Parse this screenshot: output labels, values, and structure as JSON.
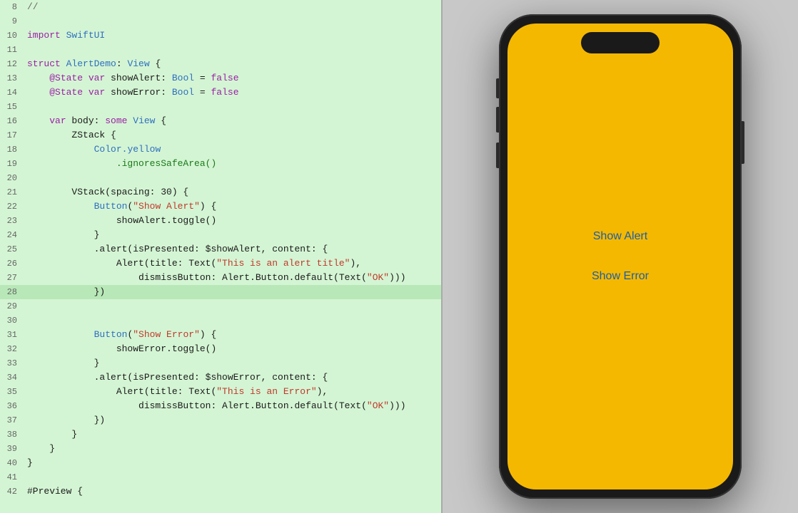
{
  "editor": {
    "background": "#d4f5d4",
    "lines": [
      {
        "num": 8,
        "tokens": [
          {
            "text": "//",
            "class": "comment"
          }
        ],
        "highlighted": false
      },
      {
        "num": 9,
        "tokens": [],
        "highlighted": false
      },
      {
        "num": 10,
        "tokens": [
          {
            "text": "import ",
            "class": "kw"
          },
          {
            "text": "SwiftUI",
            "class": "type"
          }
        ],
        "highlighted": false
      },
      {
        "num": 11,
        "tokens": [],
        "highlighted": false
      },
      {
        "num": 12,
        "tokens": [
          {
            "text": "struct ",
            "class": "kw"
          },
          {
            "text": "AlertDemo",
            "class": "type"
          },
          {
            "text": ": ",
            "class": "plain"
          },
          {
            "text": "View",
            "class": "type"
          },
          {
            "text": " {",
            "class": "plain"
          }
        ],
        "highlighted": false
      },
      {
        "num": 13,
        "tokens": [
          {
            "text": "    ",
            "class": "plain"
          },
          {
            "text": "@State",
            "class": "kw"
          },
          {
            "text": " ",
            "class": "plain"
          },
          {
            "text": "var",
            "class": "kw"
          },
          {
            "text": " showAlert: ",
            "class": "plain"
          },
          {
            "text": "Bool",
            "class": "type"
          },
          {
            "text": " = ",
            "class": "plain"
          },
          {
            "text": "false",
            "class": "kw"
          }
        ],
        "highlighted": false
      },
      {
        "num": 14,
        "tokens": [
          {
            "text": "    ",
            "class": "plain"
          },
          {
            "text": "@State",
            "class": "kw"
          },
          {
            "text": " ",
            "class": "plain"
          },
          {
            "text": "var",
            "class": "kw"
          },
          {
            "text": " showError: ",
            "class": "plain"
          },
          {
            "text": "Bool",
            "class": "type"
          },
          {
            "text": " = ",
            "class": "plain"
          },
          {
            "text": "false",
            "class": "kw"
          }
        ],
        "highlighted": false
      },
      {
        "num": 15,
        "tokens": [],
        "highlighted": false
      },
      {
        "num": 16,
        "tokens": [
          {
            "text": "    ",
            "class": "plain"
          },
          {
            "text": "var",
            "class": "kw"
          },
          {
            "text": " body: ",
            "class": "plain"
          },
          {
            "text": "some",
            "class": "kw"
          },
          {
            "text": " ",
            "class": "plain"
          },
          {
            "text": "View",
            "class": "type"
          },
          {
            "text": " {",
            "class": "plain"
          }
        ],
        "highlighted": false
      },
      {
        "num": 17,
        "tokens": [
          {
            "text": "        ZStack {",
            "class": "plain"
          }
        ],
        "highlighted": false
      },
      {
        "num": 18,
        "tokens": [
          {
            "text": "            ",
            "class": "plain"
          },
          {
            "text": "Color",
            "class": "type"
          },
          {
            "text": ".yellow",
            "class": "prop"
          }
        ],
        "highlighted": false
      },
      {
        "num": 19,
        "tokens": [
          {
            "text": "                .ignoresSafeArea()",
            "class": "func"
          }
        ],
        "highlighted": false
      },
      {
        "num": 20,
        "tokens": [],
        "highlighted": false
      },
      {
        "num": 21,
        "tokens": [
          {
            "text": "        VStack(spacing: 30) {",
            "class": "plain"
          }
        ],
        "highlighted": false
      },
      {
        "num": 22,
        "tokens": [
          {
            "text": "            ",
            "class": "plain"
          },
          {
            "text": "Button",
            "class": "type"
          },
          {
            "text": "(",
            "class": "plain"
          },
          {
            "text": "\"Show Alert\"",
            "class": "str"
          },
          {
            "text": ") {",
            "class": "plain"
          }
        ],
        "highlighted": false
      },
      {
        "num": 23,
        "tokens": [
          {
            "text": "                showAlert.toggle()",
            "class": "plain"
          }
        ],
        "highlighted": false
      },
      {
        "num": 24,
        "tokens": [
          {
            "text": "            }",
            "class": "plain"
          }
        ],
        "highlighted": false
      },
      {
        "num": 25,
        "tokens": [
          {
            "text": "            .alert(isPresented: $showAlert, content: {",
            "class": "plain"
          }
        ],
        "highlighted": false
      },
      {
        "num": 26,
        "tokens": [
          {
            "text": "                Alert(title: Text(",
            "class": "plain"
          },
          {
            "text": "\"This is an alert title\"",
            "class": "str"
          },
          {
            "text": "),",
            "class": "plain"
          }
        ],
        "highlighted": false
      },
      {
        "num": 27,
        "tokens": [
          {
            "text": "                    dismissButton: Alert.Button.default(Text(",
            "class": "plain"
          },
          {
            "text": "\"OK\"",
            "class": "str"
          },
          {
            "text": ")))",
            "class": "plain"
          }
        ],
        "highlighted": false
      },
      {
        "num": 28,
        "tokens": [
          {
            "text": "            })",
            "class": "plain"
          }
        ],
        "highlighted": true
      },
      {
        "num": 29,
        "tokens": [],
        "highlighted": false
      },
      {
        "num": 30,
        "tokens": [],
        "highlighted": false
      },
      {
        "num": 31,
        "tokens": [
          {
            "text": "            ",
            "class": "plain"
          },
          {
            "text": "Button",
            "class": "type"
          },
          {
            "text": "(",
            "class": "plain"
          },
          {
            "text": "\"Show Error\"",
            "class": "str"
          },
          {
            "text": ") {",
            "class": "plain"
          }
        ],
        "highlighted": false
      },
      {
        "num": 32,
        "tokens": [
          {
            "text": "                showError.toggle()",
            "class": "plain"
          }
        ],
        "highlighted": false
      },
      {
        "num": 33,
        "tokens": [
          {
            "text": "            }",
            "class": "plain"
          }
        ],
        "highlighted": false
      },
      {
        "num": 34,
        "tokens": [
          {
            "text": "            .alert(isPresented: $showError, content: {",
            "class": "plain"
          }
        ],
        "highlighted": false
      },
      {
        "num": 35,
        "tokens": [
          {
            "text": "                Alert(title: Text(",
            "class": "plain"
          },
          {
            "text": "\"This is an Error\"",
            "class": "str"
          },
          {
            "text": "),",
            "class": "plain"
          }
        ],
        "highlighted": false
      },
      {
        "num": 36,
        "tokens": [
          {
            "text": "                    dismissButton: Alert.Button.default(Text(",
            "class": "plain"
          },
          {
            "text": "\"OK\"",
            "class": "str"
          },
          {
            "text": ")))",
            "class": "plain"
          }
        ],
        "highlighted": false
      },
      {
        "num": 37,
        "tokens": [
          {
            "text": "            })",
            "class": "plain"
          }
        ],
        "highlighted": false
      },
      {
        "num": 38,
        "tokens": [
          {
            "text": "        }",
            "class": "plain"
          }
        ],
        "highlighted": false
      },
      {
        "num": 39,
        "tokens": [
          {
            "text": "    }",
            "class": "plain"
          }
        ],
        "highlighted": false
      },
      {
        "num": 40,
        "tokens": [
          {
            "text": "}",
            "class": "plain"
          }
        ],
        "highlighted": false
      },
      {
        "num": 41,
        "tokens": [],
        "highlighted": false
      },
      {
        "num": 42,
        "tokens": [
          {
            "text": "#Preview {",
            "class": "plain"
          }
        ],
        "highlighted": false
      }
    ]
  },
  "phone": {
    "background_color": "#F5B800",
    "buttons": [
      {
        "label": "Show Alert",
        "name": "show-alert-button"
      },
      {
        "label": "Show Error",
        "name": "show-error-button"
      }
    ]
  }
}
